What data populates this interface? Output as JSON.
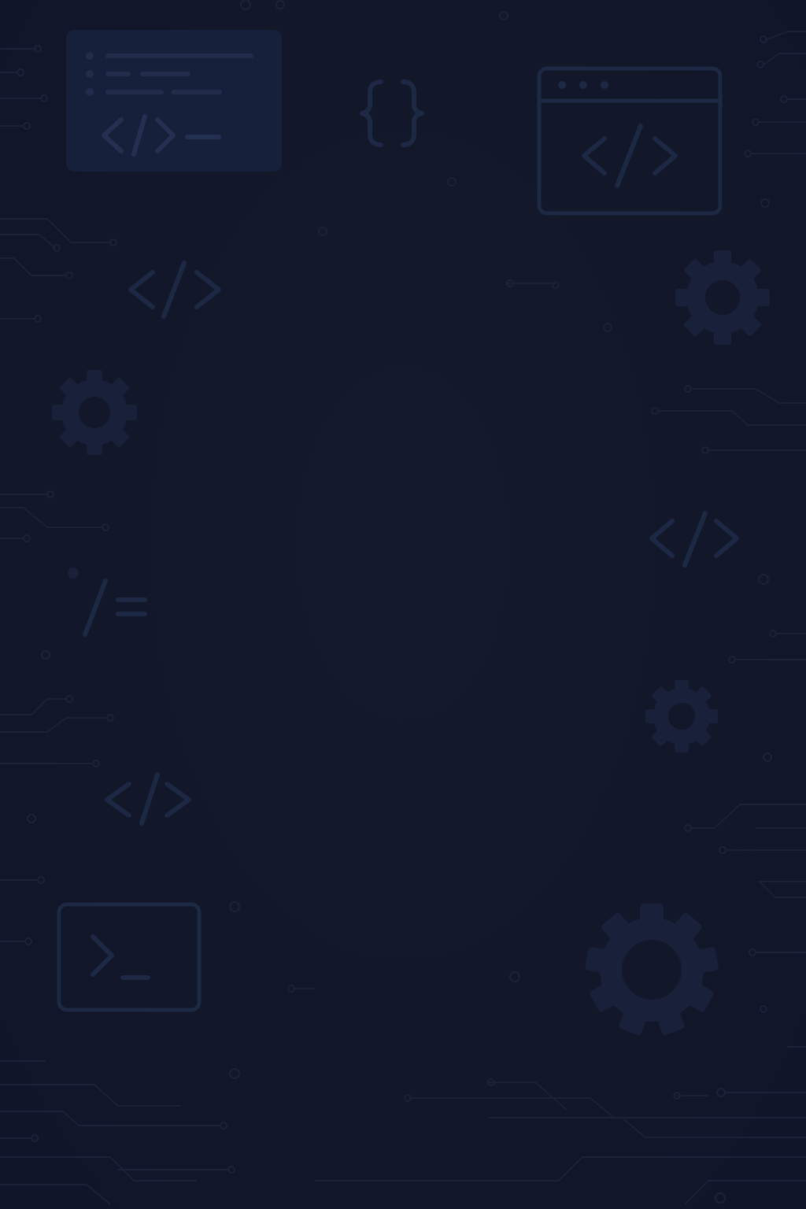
{
  "background": {
    "base_color": "#12172a",
    "icon_color": "#1d2845",
    "gear_color": "#19213a",
    "icons": [
      "code-window-icon",
      "curly-braces-icon",
      "browser-code-icon",
      "code-tag-icon",
      "gear-icon",
      "not-equal-icon",
      "terminal-icon",
      "circuit-traces"
    ]
  }
}
